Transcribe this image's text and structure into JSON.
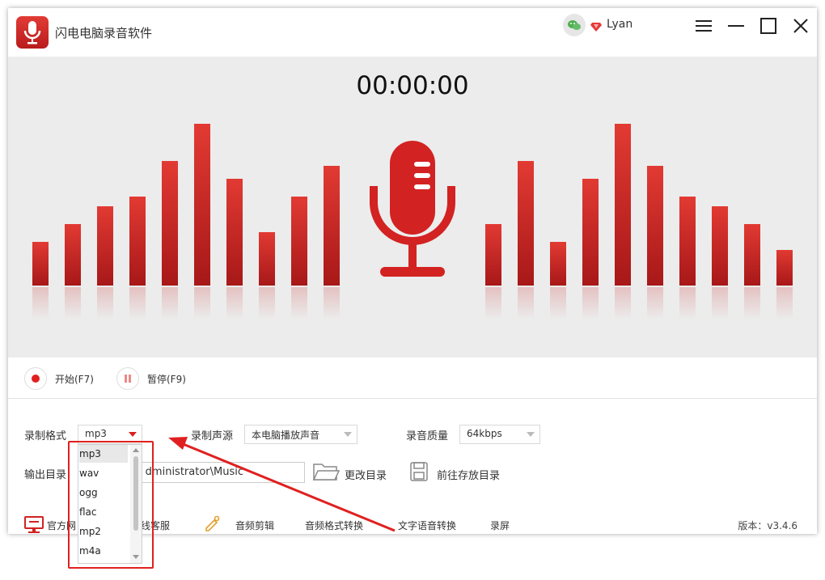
{
  "titlebar": {
    "title": "闪电电脑录音软件",
    "username": "Lyan",
    "icons": [
      "app-logo-icon",
      "wechat-icon",
      "vip-gem-icon",
      "menu-icon",
      "minimize-icon",
      "maximize-icon",
      "close-icon"
    ]
  },
  "visualizer": {
    "timer": "00:00:00",
    "level_bars_left": [
      0.27,
      0.38,
      0.49,
      0.55,
      0.77,
      1.0,
      0.66,
      0.33,
      0.55,
      0.74
    ],
    "level_bars_right": [
      0.38,
      0.77,
      0.27,
      0.66,
      1.0,
      0.74,
      0.55,
      0.49,
      0.38,
      0.22
    ],
    "accent": "#d32222"
  },
  "controls": {
    "start_label": "开始(F7)",
    "pause_label": "暂停(F9)"
  },
  "settings": {
    "format_label": "录制格式",
    "format_value": "mp3",
    "format_options": [
      "mp3",
      "wav",
      "ogg",
      "flac",
      "mp2",
      "m4a"
    ],
    "source_label": "录制声源",
    "source_value": "本电脑播放声音",
    "quality_label": "录音质量",
    "quality_value": "64kbps",
    "output_label": "输出目录",
    "output_path": "dministrator\\Music",
    "change_dir_label": "更改目录",
    "open_dir_label": "前往存放目录"
  },
  "bottombar": {
    "official_site": "官方网",
    "online_service": "在线客服",
    "audio_edit": "音频剪辑",
    "format_convert": "音频格式转换",
    "tts": "文字语音转换",
    "screen_record": "录屏",
    "version": "版本：v3.4.6"
  }
}
